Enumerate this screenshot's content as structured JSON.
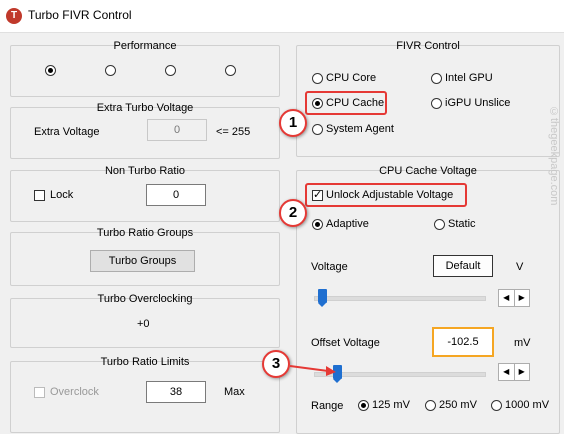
{
  "window": {
    "app_icon_letter": "T",
    "title": "Turbo FIVR Control"
  },
  "performance": {
    "title": "Performance",
    "selected_index": 0,
    "radio_count": 4
  },
  "extra_turbo_voltage": {
    "title": "Extra Turbo Voltage",
    "label": "Extra Voltage",
    "value": "0",
    "limit": "<= 255"
  },
  "non_turbo_ratio": {
    "title": "Non Turbo Ratio",
    "lock_label": "Lock",
    "lock_checked": false,
    "value": "0"
  },
  "turbo_ratio_groups": {
    "title": "Turbo Ratio Groups",
    "button_label": "Turbo Groups"
  },
  "turbo_overclocking": {
    "title": "Turbo Overclocking",
    "value": "+0"
  },
  "turbo_ratio_limits": {
    "title": "Turbo Ratio Limits",
    "overclock_label": "Overclock",
    "overclock_checked": false,
    "value": "38",
    "max_label": "Max"
  },
  "fivr_control": {
    "title": "FIVR Control",
    "options": [
      "CPU Core",
      "Intel GPU",
      "CPU Cache",
      "iGPU Unslice",
      "System Agent"
    ],
    "selected": "CPU Cache"
  },
  "cpu_cache_voltage": {
    "title": "CPU Cache Voltage",
    "unlock_label": "Unlock Adjustable Voltage",
    "unlock_checked": true,
    "mode_options": [
      "Adaptive",
      "Static"
    ],
    "mode_selected": "Adaptive",
    "voltage_label": "Voltage",
    "voltage_value": "Default",
    "voltage_unit": "V",
    "offset_label": "Offset Voltage",
    "offset_value": "-102.5",
    "offset_unit": "mV",
    "range_label": "Range",
    "range_options": [
      "125 mV",
      "250 mV",
      "1000 mV"
    ],
    "range_selected": "125 mV"
  },
  "callouts": [
    "1",
    "2",
    "3"
  ],
  "watermark": "©thegeekpage.com",
  "colors": {
    "highlight": "#e53935",
    "offset_border": "#f5a623",
    "slider_thumb": "#1f6fd0",
    "app_icon": "#c0392b"
  }
}
